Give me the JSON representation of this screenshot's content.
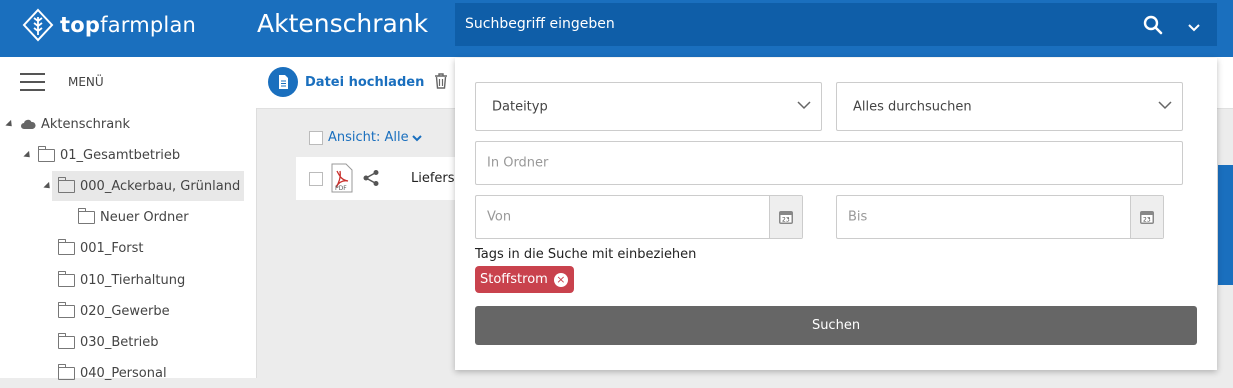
{
  "app": {
    "logo_bold": "top",
    "logo_rest": "farmplan",
    "title": "Aktenschrank"
  },
  "search": {
    "placeholder": "Suchbegriff eingeben"
  },
  "menu": {
    "label": "MENÜ"
  },
  "toolbar": {
    "upload_label": "Datei hochladen"
  },
  "list": {
    "view_label": "Ansicht: Alle",
    "row_text": "Liefersc"
  },
  "tree": [
    {
      "label": "Aktenschrank",
      "icon": "cloud-icon"
    },
    {
      "label": "01_Gesamtbetrieb",
      "icon": "folder-icon"
    },
    {
      "label": "000_Ackerbau, Grünland",
      "icon": "folder-icon",
      "selected": true
    },
    {
      "label": "Neuer Ordner",
      "icon": "folder-icon"
    },
    {
      "label": "001_Forst",
      "icon": "folder-icon"
    },
    {
      "label": "010_Tierhaltung",
      "icon": "folder-icon"
    },
    {
      "label": "020_Gewerbe",
      "icon": "folder-icon"
    },
    {
      "label": "030_Betrieb",
      "icon": "folder-icon"
    },
    {
      "label": "040_Personal",
      "icon": "folder-icon"
    }
  ],
  "filter": {
    "filetype_value": "Dateityp",
    "scope_value": "Alles durchsuchen",
    "folder_placeholder": "In Ordner",
    "from_placeholder": "Von",
    "to_placeholder": "Bis",
    "tags_label": "Tags in die Suche mit einbeziehen",
    "tag": "Stoffstrom",
    "submit_label": "Suchen"
  },
  "colors": {
    "brand": "#1a6fbe",
    "tag": "#c9424d",
    "button": "#666666"
  }
}
